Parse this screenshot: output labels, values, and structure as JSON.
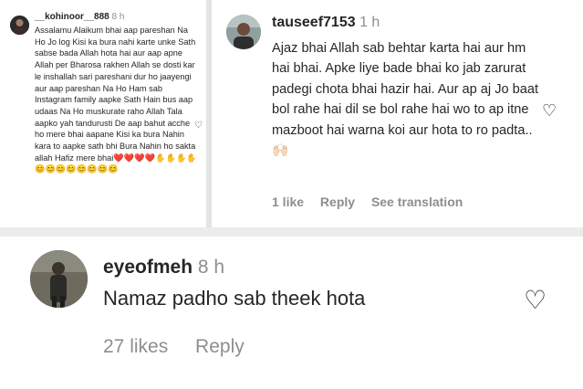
{
  "left_comment": {
    "username": "__kohinoor__888",
    "time": "8 h",
    "text": "Assalamu Alaikum bhai aap pareshan Na Ho Jo log Kisi ka bura nahi karte unke Sath sabse bada Allah hota hai aur aap apne Allah per Bharosa rakhen Allah se dosti kar le inshallah sari pareshani dur ho jaayengi aur aap pareshan Na Ho Ham sab Instagram family aapke Sath Hain bus aap udaas Na Ho muskurate raho Allah Tala aapko yah tandurusti De aap bahut acche ho mere bhai aapane Kisi ka bura Nahin kara to aapke sath bhi Bura Nahin ho sakta allah Hafiz mere bhai❤️❤️❤️❤️✋✋✋✋😊😊😊😊😊😊😊😊",
    "like_icon": "heart-outline-icon"
  },
  "right_comment": {
    "username": "tauseef7153",
    "time": "1 h",
    "text": "Ajaz bhai Allah sab behtar karta hai aur hm hai bhai. Apke liye bade bhai ko jab zarurat padegi chota bhai hazir hai. Aur ap aj Jo baat bol rahe hai dil se bol rahe hai wo to ap itne mazboot hai warna koi aur hota to ro padta.. 🙌🏻",
    "likes": "1 like",
    "reply": "Reply",
    "see_translation": "See translation",
    "like_icon": "heart-outline-icon"
  },
  "bottom_comment": {
    "username": "eyeofmeh",
    "time": "8 h",
    "text": "Namaz padho sab theek hota",
    "likes": "27 likes",
    "reply": "Reply",
    "like_icon": "heart-outline-icon"
  },
  "colors": {
    "text": "#262626",
    "muted": "#8e8e8e",
    "separator": "#ececec"
  }
}
